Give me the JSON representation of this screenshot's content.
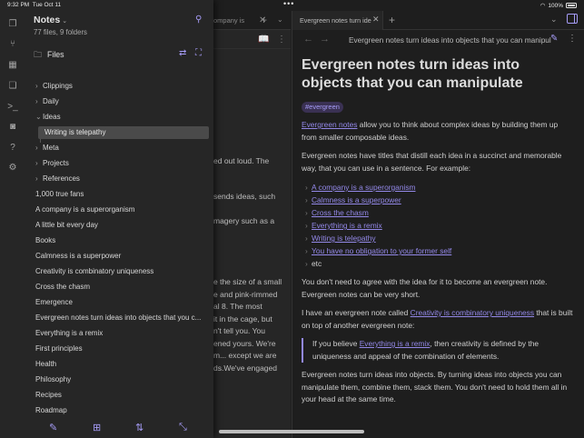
{
  "status": {
    "time": "9:32 PM",
    "date": "Tue Oct 11",
    "battery": "100%"
  },
  "colors": {
    "accent": "#a69cf7",
    "link": "#9388e8",
    "sidebar_bg": "#262626",
    "content_bg": "#1e1e1e"
  },
  "ribbon_icons": [
    "files-icon",
    "graph-icon",
    "calendar-icon",
    "copy-icon",
    "terminal-icon",
    "camera-icon",
    "help-icon",
    "settings-icon"
  ],
  "sidebar": {
    "vault_name": "Notes",
    "counts": "77 files, 9 folders",
    "files_label": "Files",
    "tree": [
      {
        "label": "Clippings",
        "type": "folder",
        "open": false
      },
      {
        "label": "Daily",
        "type": "folder",
        "open": false
      },
      {
        "label": "Ideas",
        "type": "folder",
        "open": true
      },
      {
        "label": "Writing is telepathy",
        "type": "file",
        "selected": true
      },
      {
        "label": "Meta",
        "type": "folder",
        "open": false
      },
      {
        "label": "Projects",
        "type": "folder",
        "open": false
      },
      {
        "label": "References",
        "type": "folder",
        "open": false
      },
      {
        "label": "1,000 true fans",
        "type": "file"
      },
      {
        "label": "A company is a superorganism",
        "type": "file"
      },
      {
        "label": "A little bit every day",
        "type": "file"
      },
      {
        "label": "Books",
        "type": "file"
      },
      {
        "label": "Calmness is a superpower",
        "type": "file"
      },
      {
        "label": "Creativity is combinatory uniqueness",
        "type": "file"
      },
      {
        "label": "Cross the chasm",
        "type": "file"
      },
      {
        "label": "Emergence",
        "type": "file"
      },
      {
        "label": "Evergreen notes turn ideas into objects that you c...",
        "type": "file"
      },
      {
        "label": "Everything is a remix",
        "type": "file"
      },
      {
        "label": "First principles",
        "type": "file"
      },
      {
        "label": "Health",
        "type": "file"
      },
      {
        "label": "Philosophy",
        "type": "file"
      },
      {
        "label": "Recipes",
        "type": "file"
      },
      {
        "label": "Roadmap",
        "type": "file"
      }
    ]
  },
  "background_pane": {
    "tab_title": "ompany is",
    "paragraphs": [
      "ed out loud. The",
      "sends ideas, such",
      "magery such as a",
      "e the size of a small\ne and pink-rimmed\nal 8. The most\nit in the cage, but\nn't tell you. You\nened yours. We're\nm... except we are\nds.We've engaged"
    ]
  },
  "note": {
    "tab_title": "Evergreen notes turn ide",
    "nav_title": "Evergreen notes turn ideas into objects that you can manipul",
    "title": "Evergreen notes turn ideas into objects that you can manipulate",
    "tag": "#evergreen",
    "p1_link": "Evergreen notes",
    "p1_rest": " allow you to think about complex ideas by building them up from smaller composable ideas.",
    "p2": "Evergreen notes have titles that distill each idea in a succinct and memorable way, that you can use in a sentence. For example:",
    "list_links": [
      "A company is a superorganism",
      "Calmness is a superpower",
      "Cross the chasm",
      "Everything is a remix",
      "Writing is telepathy",
      "You have no obligation to your former self"
    ],
    "list_etc": "etc",
    "p3": "You don't need to agree with the idea for it to become an evergreen note. Evergreen notes can be very short.",
    "p4_start": "I have an evergreen note called ",
    "p4_link": "Creativity is combinatory uniqueness",
    "p4_end": " that is built on top of another evergreen note:",
    "quote_start": "If you believe ",
    "quote_link": "Everything is a remix",
    "quote_end": ", then creativity is defined by the uniqueness and appeal of the combination of elements.",
    "p5": "Evergreen notes turn ideas into objects. By turning ideas into objects you can manipulate them, combine them, stack them. You don't need to hold them all in your head at the same time."
  }
}
